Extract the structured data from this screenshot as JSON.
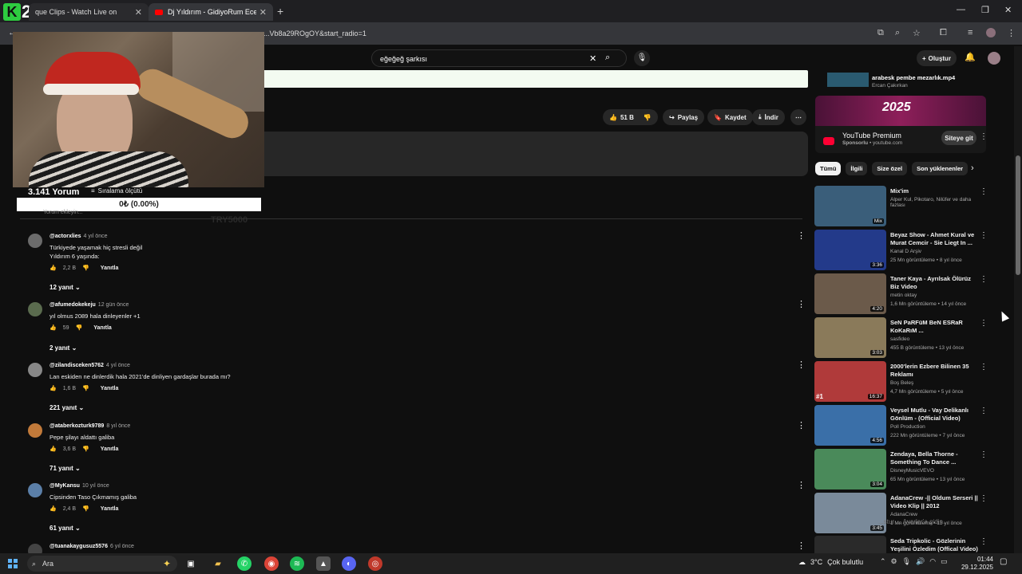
{
  "browser": {
    "tabs": [
      {
        "title": "que Clips - Watch Live on"
      },
      {
        "title": "Dj Yıldırım - GidiyoRum EceLe"
      }
    ],
    "url": "...Vb8a29ROgOY&start_radio=1"
  },
  "logo": {
    "k": "K",
    "num": "22"
  },
  "youtube": {
    "search_value": "eğeğeğ şarkısı",
    "create_label": "Oluştur",
    "actions": {
      "like_count": "51 B",
      "share": "Paylaş",
      "save": "Kaydet",
      "download": "İndir"
    }
  },
  "comments_header": {
    "count": "3.141 Yorum",
    "sort_label": "Sıralama ölçütü",
    "add_placeholder": "Yorum ekleyin...",
    "ghost_text": "TRY5000"
  },
  "donation": {
    "text": "0₺ (0.00%)"
  },
  "comments": [
    {
      "author": "@actorxlies",
      "time": "4 yıl önce",
      "lines": [
        "Türkiyede yaşamak hiç stresli değil",
        "Yıldırım 6 yaşında:"
      ],
      "likes": "2,2 B",
      "reply": "Yanıtla",
      "replies": "12 yanıt",
      "avatar": "#6b6b6b"
    },
    {
      "author": "@afumedokekeju",
      "time": "12 gün önce",
      "lines": [
        "yıl olmus 2089 hala dinleyenler +1"
      ],
      "likes": "59",
      "reply": "Yanıtla",
      "replies": "2 yanıt",
      "avatar": "#5a6b4e"
    },
    {
      "author": "@zilandisceken5762",
      "time": "4 yıl önce",
      "lines": [
        "Lan eskiden ne dinlerdik  hala 2021'de dinliyen gardaşlar burada mı?"
      ],
      "likes": "1,6 B",
      "reply": "Yanıtla",
      "replies": "221 yanıt",
      "avatar": "#888888"
    },
    {
      "author": "@ataberkozturk9789",
      "time": "8 yıl önce",
      "lines": [
        "Pepe şilayı aldattı galiba"
      ],
      "likes": "3,6 B",
      "reply": "Yanıtla",
      "replies": "71 yanıt",
      "avatar": "#c27a3a"
    },
    {
      "author": "@MyKansu",
      "time": "10 yıl önce",
      "lines": [
        "Cipsinden Taso Çıkmamış galiba"
      ],
      "likes": "2,4 B",
      "reply": "Yanıtla",
      "replies": "61 yanıt",
      "avatar": "#5b7fa8"
    },
    {
      "author": "@tuanakaygusuz5576",
      "time": "6 yıl önce",
      "lines": [
        ""
      ],
      "likes": "",
      "reply": "",
      "replies": "",
      "avatar": "#444444"
    }
  ],
  "sidebar": {
    "prev_video": {
      "title": "arabesk pembe mezarlık.mp4",
      "channel": "Ercan Çakırkan"
    },
    "premium": {
      "image_text": "2025",
      "name": "YouTube Premium",
      "sponsored": "Sponsorlu",
      "domain": "youtube.com",
      "cta": "Siteye git"
    },
    "chips": [
      "Tümü",
      "İlgili",
      "Size özel",
      "Son yüklenenler"
    ],
    "recommendations": [
      {
        "title": "Mix'im",
        "channel": "Alper Kul, Pikotaro, Nilüfer ve daha fazlası",
        "meta": "",
        "badge": "Mix",
        "thumb": "#3a5e7a"
      },
      {
        "title": "Beyaz Show - Ahmet Kural ve Murat Cemcir - Sie Liegt In ...",
        "channel": "Kanal D Arşiv",
        "meta": "25 Mn görüntüleme • 8 yıl önce",
        "badge": "3:36",
        "thumb": "#233a8a"
      },
      {
        "title": "Taner Kaya - Ayrılsak Ölürüz Biz Video",
        "channel": "metin oktay",
        "meta": "1,6 Mn görüntüleme • 14 yıl önce",
        "badge": "4:20",
        "thumb": "#6b5a4a"
      },
      {
        "title": "SeN PaRFüM BeN ESRaR KoKaRıM ...",
        "channel": "sasfideo",
        "meta": "455 B görüntüleme • 13 yıl önce",
        "badge": "3:03",
        "thumb": "#8a7a5a"
      },
      {
        "title": "2000'lerin Ezbere Bilinen 35 Reklamı",
        "channel": "Boş Beleş",
        "meta": "4,7 Mn görüntüleme • 5 yıl önce",
        "badge": "16:37",
        "rank": "#1",
        "thumb": "#b03a3a"
      },
      {
        "title": "Veysel Mutlu - Vay Delikanlı Gönlüm - (Official Video)",
        "channel": "Poll Production",
        "meta": "222 Mn görüntüleme • 7 yıl önce",
        "badge": "4:56",
        "thumb": "#3a6fa8"
      },
      {
        "title": "Zendaya, Bella Thorne - Something To Dance ...",
        "channel": "DisneyMusicVEVO",
        "meta": "65 Mn görüntüleme • 13 yıl önce",
        "badge": "3:04",
        "thumb": "#4a8a5a"
      },
      {
        "title": "AdanaCrew -|| Oldum Serseri || Video Klip || 2012",
        "channel": "AdanaCrew",
        "meta": "1 Mn görüntüleme • 13 yıl önce",
        "badge": "3:45",
        "thumb": "#7a8a9a"
      },
      {
        "title": "Seda Tripkolic - Gözlerinin Yeşilini Özledim (Offical Video)",
        "channel": "",
        "meta": "",
        "badge": "",
        "thumb": "#2a2a2a"
      }
    ]
  },
  "overlay_hint": "...stur ... Ayarlar'a gidin.",
  "taskbar": {
    "search": "Ara",
    "weather_temp": "3°C",
    "weather_text": "Çok bulutlu",
    "time": "01:44",
    "date": "29.12.2025"
  }
}
